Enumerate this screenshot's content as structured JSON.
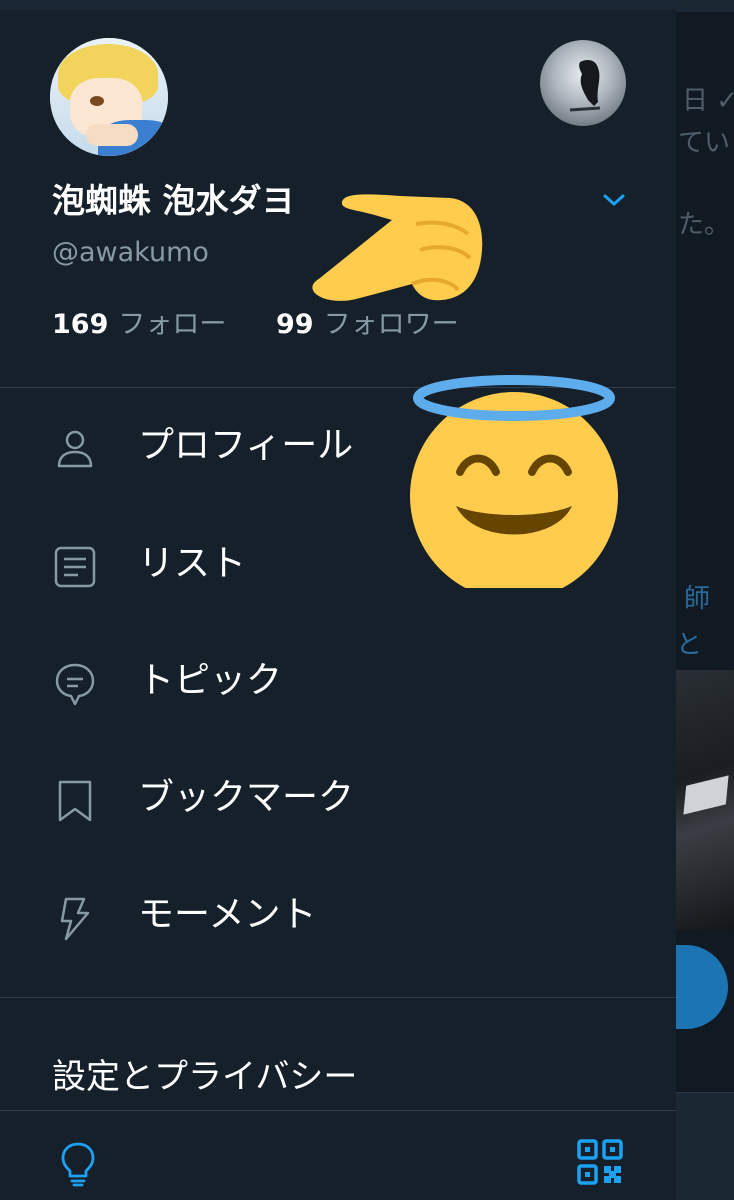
{
  "profile": {
    "display_name": "泡蜘蛛 泡水ダヨ",
    "handle": "@awakumo",
    "following_count": "169",
    "following_label": "フォロー",
    "followers_count": "99",
    "followers_label": "フォロワー"
  },
  "menu": {
    "items": [
      {
        "label": "プロフィール",
        "icon": "person-icon"
      },
      {
        "label": "リスト",
        "icon": "list-icon"
      },
      {
        "label": "トピック",
        "icon": "topic-icon"
      },
      {
        "label": "ブックマーク",
        "icon": "bookmark-icon"
      },
      {
        "label": "モーメント",
        "icon": "lightning-icon"
      }
    ],
    "settings_label": "設定とプライバシー"
  },
  "footer": {
    "left_icon": "lightbulb-icon",
    "right_icon": "qr-code-icon"
  },
  "background_timeline": {
    "fragments": [
      "日 ✓",
      "てい",
      "た。",
      "師",
      "と"
    ]
  },
  "colors": {
    "background": "#15202b",
    "accent": "#1da1f2",
    "text_primary": "#ffffff",
    "text_secondary": "#8899a6",
    "icon": "#8899a6"
  }
}
